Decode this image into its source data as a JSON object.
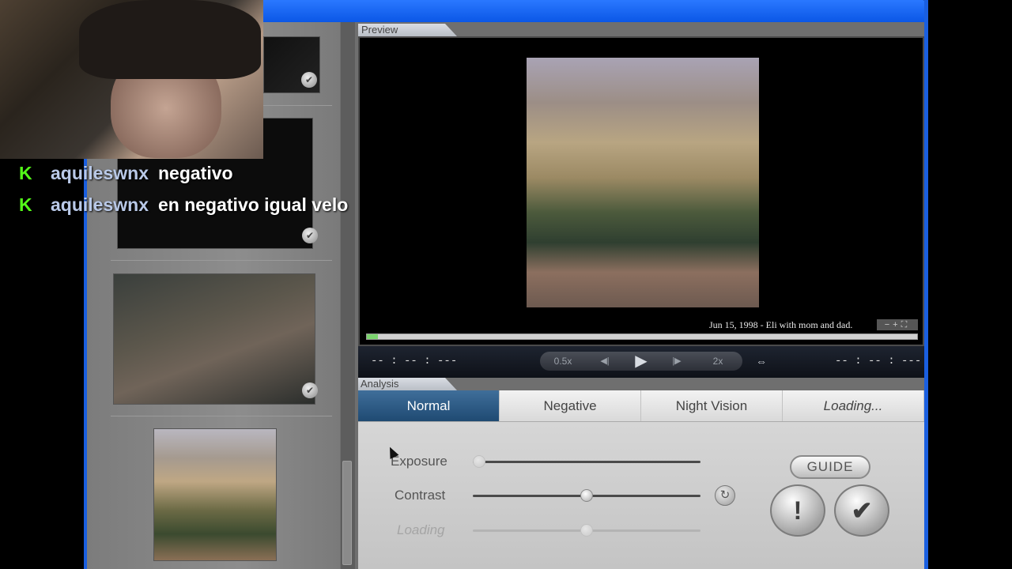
{
  "preview": {
    "tab_label": "Preview",
    "caption": "Jun 15, 1998 - Eli with mom and dad.",
    "zoom_controls": "−+⛶",
    "progress_percent": 2
  },
  "transport": {
    "time_left": "-- : -- : ---",
    "time_right": "-- : -- : ---",
    "slow_label": "0.5x",
    "fast_label": "2x",
    "step_back_icon": "◀|",
    "play_icon": "▶",
    "step_forward_icon": "|▶",
    "loop_icon": "⇔"
  },
  "analysis": {
    "tab_label": "Analysis",
    "modes": [
      {
        "label": "Normal"
      },
      {
        "label": "Negative"
      },
      {
        "label": "Night Vision"
      },
      {
        "label": "Loading..."
      }
    ],
    "sliders": {
      "exposure_label": "Exposure",
      "exposure_value": 0.0,
      "contrast_label": "Contrast",
      "contrast_value": 0.5,
      "loading_label": "Loading",
      "loading_value": 0.5
    },
    "guide_label": "GUIDE",
    "alert_icon": "!",
    "confirm_icon": "✔",
    "reset_icon": "↻"
  },
  "thumbnails": {
    "check_icon": "✔"
  },
  "chat": {
    "messages": [
      {
        "user": "aquileswnx",
        "text": "negativo"
      },
      {
        "user": "aquileswnx",
        "text": "en negativo igual velo"
      }
    ]
  }
}
